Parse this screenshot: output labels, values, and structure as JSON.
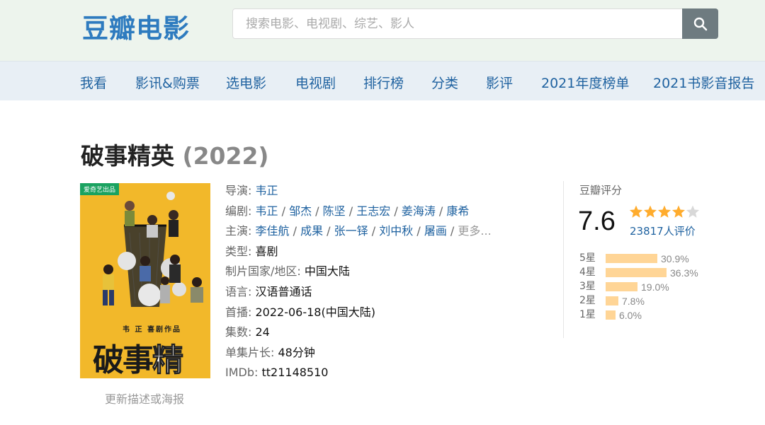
{
  "header": {
    "logo": "豆瓣电影",
    "search_placeholder": "搜索电影、电视剧、综艺、影人",
    "search_button_icon": "search-icon"
  },
  "nav": {
    "items": [
      {
        "label": "我看"
      },
      {
        "label": "影讯&购票"
      },
      {
        "label": "选电影"
      },
      {
        "label": "电视剧"
      },
      {
        "label": "排行榜"
      },
      {
        "label": "分类"
      },
      {
        "label": "影评"
      },
      {
        "label": "2021年度榜单"
      },
      {
        "label": "2021书影音报告"
      }
    ]
  },
  "title": {
    "name": "破事精英",
    "year": "(2022)"
  },
  "poster": {
    "badge": "爱奇艺出品",
    "credit": "韦 正 喜剧作品",
    "title_part1": "破事",
    "title_part2": "精英",
    "update_link": "更新描述或海报"
  },
  "info": {
    "director_label": "导演",
    "director": "韦正",
    "writer_label": "编剧",
    "writers": [
      "韦正",
      "邹杰",
      "陈坚",
      "王志宏",
      "姜海涛",
      "康希"
    ],
    "cast_label": "主演",
    "cast": [
      "李佳航",
      "成果",
      "张一铎",
      "刘中秋",
      "屠画"
    ],
    "cast_more": "更多...",
    "genre_label": "类型",
    "genre": "喜剧",
    "country_label": "制片国家/地区",
    "country": "中国大陆",
    "language_label": "语言",
    "language": "汉语普通话",
    "premiere_label": "首播",
    "premiere": "2022-06-18(中国大陆)",
    "episodes_label": "集数",
    "episodes": "24",
    "runtime_label": "单集片长",
    "runtime": "48分钟",
    "imdb_label": "IMDb",
    "imdb": "tt21148510"
  },
  "rating": {
    "title": "豆瓣评分",
    "score": "7.6",
    "stars": 4,
    "count": "23817人评价",
    "distribution": [
      {
        "label": "5星",
        "pct": "30.9%",
        "value": 30.9
      },
      {
        "label": "4星",
        "pct": "36.3%",
        "value": 36.3
      },
      {
        "label": "3星",
        "pct": "19.0%",
        "value": 19.0
      },
      {
        "label": "2星",
        "pct": "7.8%",
        "value": 7.8
      },
      {
        "label": "1星",
        "pct": "6.0%",
        "value": 6.0
      }
    ],
    "star_color": "#ffac2d",
    "bar_color": "#ffd596"
  }
}
